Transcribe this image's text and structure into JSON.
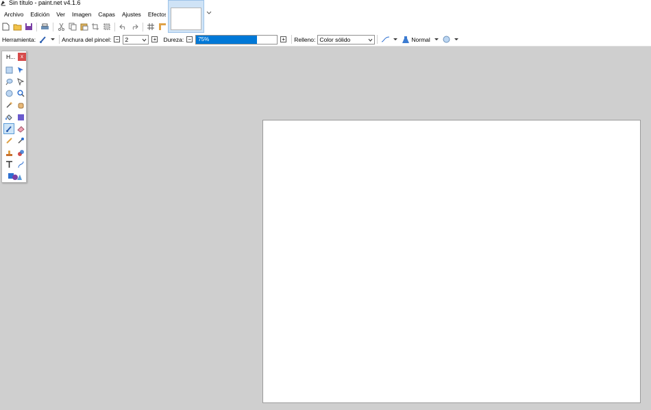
{
  "window": {
    "title": "Sin título - paint.net v4.1.6"
  },
  "menu": {
    "items": [
      "Archivo",
      "Edición",
      "Ver",
      "Imagen",
      "Capas",
      "Ajustes",
      "Efectos"
    ]
  },
  "toolbar": {
    "tool_label": "Herramienta:",
    "brush_width_label": "Anchura del pincel:",
    "brush_width_value": "2",
    "hardness_label": "Dureza:",
    "hardness_value": "75%",
    "hardness_percent": 75,
    "fill_label": "Relleno:",
    "fill_value": "Color sólido",
    "blend_mode": "Normal"
  },
  "tools_panel": {
    "title": "H...",
    "close": "x"
  },
  "colors": {
    "accent": "#0078d7",
    "workspace": "#cfcfcf",
    "close": "#d64b4b"
  }
}
